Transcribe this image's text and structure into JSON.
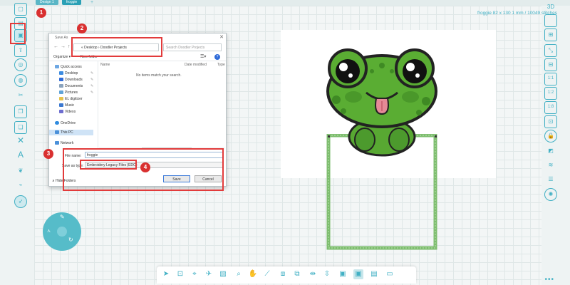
{
  "tabs": [
    {
      "label": "Design 1"
    },
    {
      "label": "froggie"
    },
    {
      "label": "+"
    }
  ],
  "canvas_info": {
    "dimensions": "froggie 82 x 130 1 mm / 10049 stitches"
  },
  "dialog": {
    "title": "Save As",
    "close": "✕",
    "back": "←",
    "forward": "→",
    "up": "↑",
    "path": "« Desktop › Doodler Projects",
    "search_placeholder": "Search Doodler Projects",
    "organize": "Organize ▾",
    "new_folder": "New folder",
    "help": "?",
    "nav_items": [
      "Quick access",
      "Desktop",
      "Downloads",
      "Documents",
      "Pictures",
      "EL digitizer",
      "Music",
      "Videos",
      "OneDrive",
      "This PC",
      "Network"
    ],
    "columns": [
      "Name",
      "Date modified",
      "Type"
    ],
    "empty_message": "No items match your search.",
    "file_name_label": "File name:",
    "file_name_value": "froggie",
    "save_type_label": "Save as type:",
    "save_type_value": "Embroidery Legacy Files (EDO)",
    "hide_folders": "∧ Hide Folders",
    "save_button": "Save",
    "cancel_button": "Cancel"
  },
  "markers": [
    "1",
    "2",
    "3",
    "4"
  ],
  "menu_dots": "•••",
  "colors": {
    "accent": "#41b0c4",
    "marker": "#d93030",
    "frog_green": "#58a832",
    "hoop_green": "#7ebd6f"
  },
  "icons": {
    "left": [
      "page-icon",
      "new-file-icon",
      "save-icon",
      "export-icon",
      "fingerprint-icon",
      "fingerprint-alt-icon",
      "scissors-icon",
      "copy-icon",
      "paste-icon",
      "cross-icon",
      "text-icon",
      "leaf-icon",
      "trace-icon",
      "cursor-icon"
    ],
    "right": [
      "3d-icon",
      "square-icon",
      "grid-icon",
      "scale-icon",
      "ruler-icon",
      "zoom-1-1-icon",
      "zoom-1-2-icon",
      "zoom-1-8-icon",
      "hoop-icon",
      "lock-icon",
      "align-icon",
      "stitch-icon",
      "layers-icon",
      "thread-icon"
    ],
    "bottom": [
      "select-arrow-icon",
      "transform-icon",
      "node-edit-icon",
      "bird-icon",
      "image-icon",
      "zoom-icon",
      "hand-icon",
      "measure-icon",
      "crop-icon",
      "distort-icon",
      "mirror-h-icon",
      "mirror-v-icon",
      "frame-1-icon",
      "frame-2-icon",
      "frame-3-icon",
      "monitor-icon"
    ]
  }
}
